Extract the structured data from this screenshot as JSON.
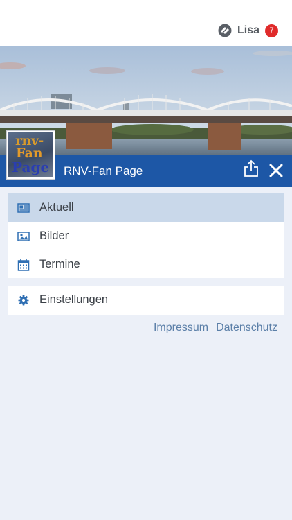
{
  "header": {
    "user_name": "Lisa",
    "notification_count": "7"
  },
  "group": {
    "title": "RNV-Fan Page",
    "thumbnail_text": {
      "line1": "rnv-",
      "line2": "Fan",
      "line3": "Page"
    }
  },
  "menu": {
    "items": [
      {
        "label": "Aktuell",
        "icon": "newspaper-icon",
        "active": true
      },
      {
        "label": "Bilder",
        "icon": "image-icon",
        "active": false
      },
      {
        "label": "Termine",
        "icon": "calendar-icon",
        "active": false
      }
    ],
    "settings": {
      "label": "Einstellungen",
      "icon": "gear-icon"
    }
  },
  "footer": {
    "impressum": "Impressum",
    "datenschutz": "Datenschutz"
  },
  "colors": {
    "accent": "#1d57a6",
    "active_bg": "#c9d8ea",
    "badge": "#e02b2b",
    "link": "#5b7fa8",
    "background": "#ecf0f8"
  }
}
